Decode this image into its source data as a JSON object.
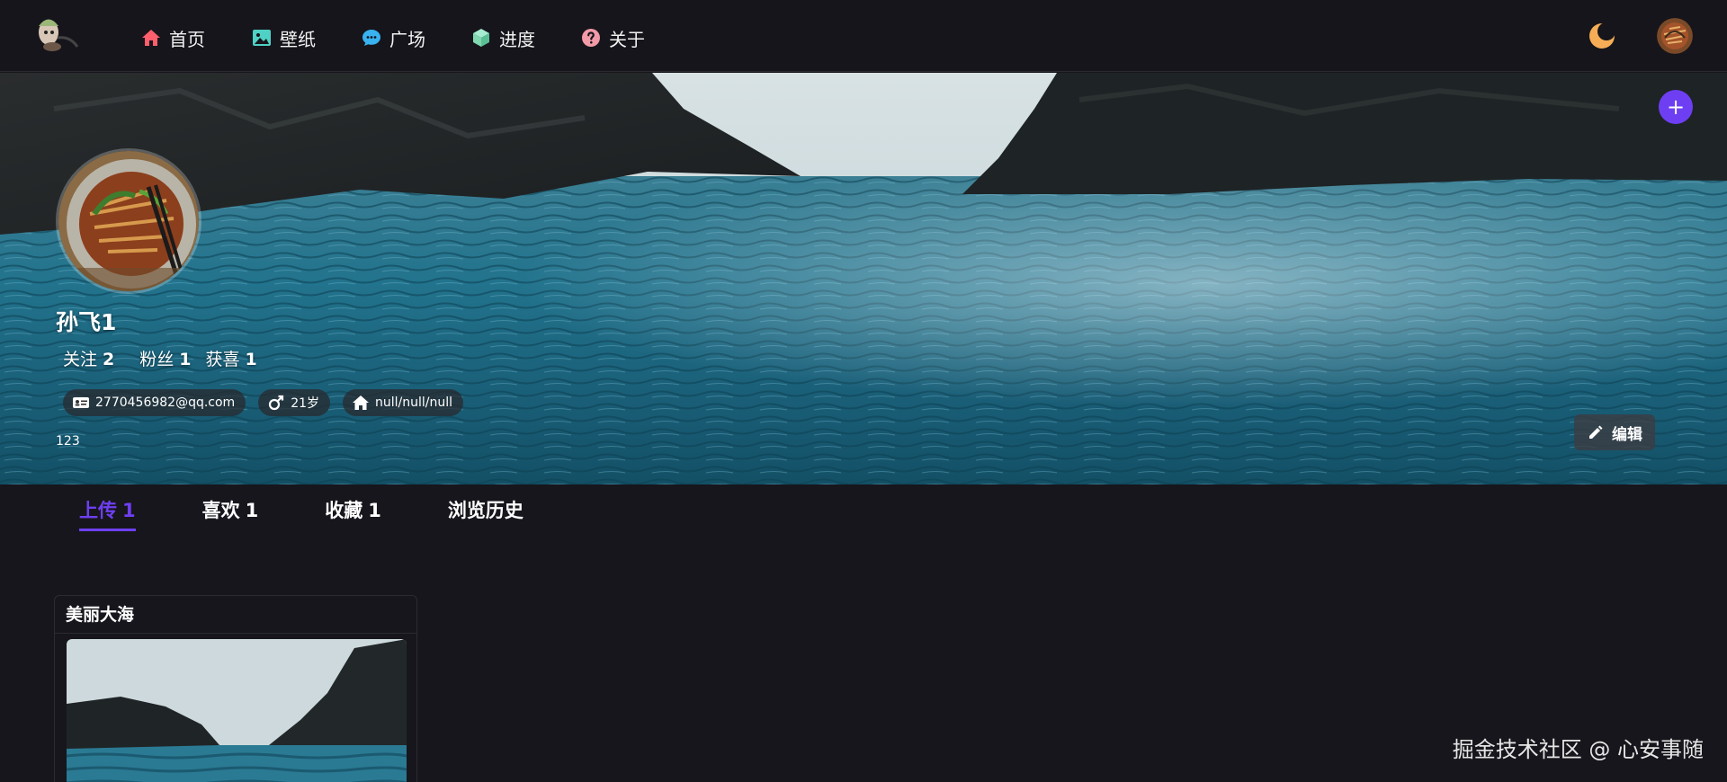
{
  "nav": {
    "items": [
      {
        "label": "首页",
        "icon": "home-icon",
        "color": "#ff5f6d"
      },
      {
        "label": "壁纸",
        "icon": "image-icon",
        "color": "#4fd1c5"
      },
      {
        "label": "广场",
        "icon": "chat-icon",
        "color": "#38b2f0"
      },
      {
        "label": "进度",
        "icon": "cube-icon",
        "color": "#7fd8b0"
      },
      {
        "label": "关于",
        "icon": "question-icon",
        "color": "#f29aa8"
      }
    ],
    "theme_icon": "moon-icon",
    "theme_color": "#f6ad55"
  },
  "profile": {
    "name": "孙飞1",
    "stats": [
      {
        "label": "关注",
        "value": "2"
      },
      {
        "label": "粉丝",
        "value": "1"
      },
      {
        "label": "获喜",
        "value": "1"
      }
    ],
    "email": "2770456982@qq.com",
    "age": "21岁",
    "location": "null/null/null",
    "bio": "123",
    "edit_label": "编辑",
    "add_label": "+"
  },
  "tabs": [
    {
      "label": "上传",
      "count": "1",
      "active": true
    },
    {
      "label": "喜欢",
      "count": "1",
      "active": false
    },
    {
      "label": "收藏",
      "count": "1",
      "active": false
    },
    {
      "label": "浏览历史",
      "count": "",
      "active": false
    }
  ],
  "cards": [
    {
      "title": "美丽大海"
    }
  ],
  "watermark": "掘金技术社区 @ 心安事随",
  "colors": {
    "accent": "#6e3ff2",
    "background": "#17161c",
    "navbar": "#16151b"
  }
}
